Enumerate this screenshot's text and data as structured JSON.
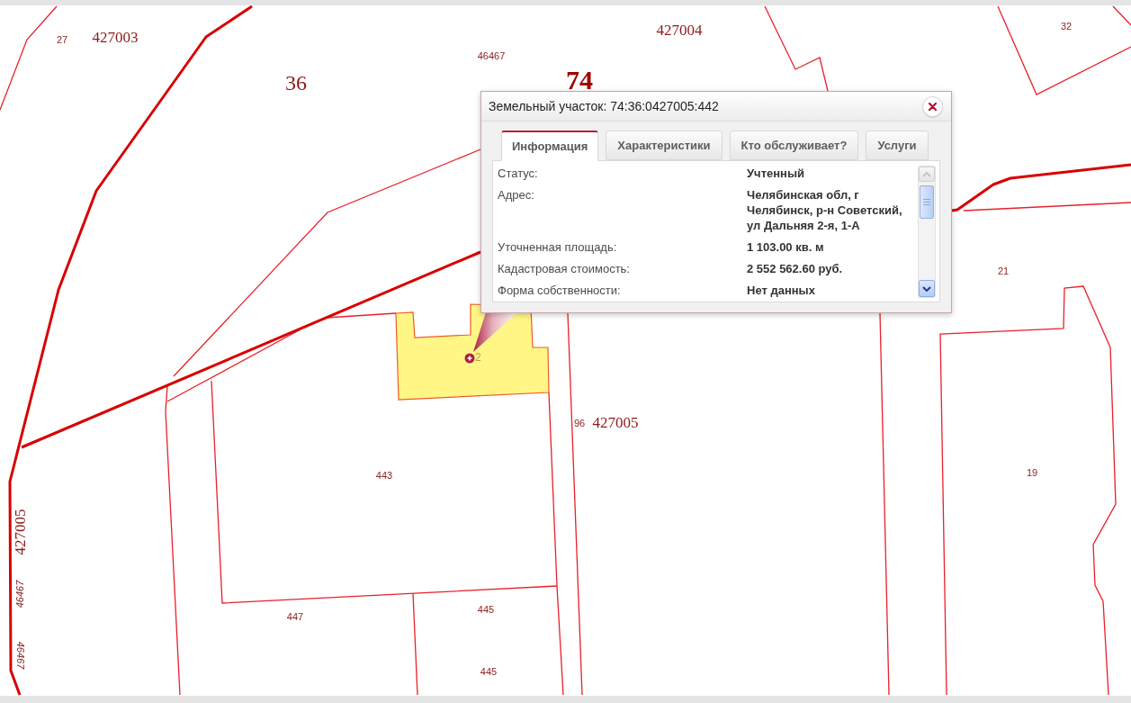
{
  "map": {
    "labels": [
      {
        "text": "27",
        "kind": "parcel"
      },
      {
        "text": "427003",
        "kind": "quarter"
      },
      {
        "text": "46467",
        "kind": "code"
      },
      {
        "text": "36",
        "kind": "district"
      },
      {
        "text": "74",
        "kind": "region"
      },
      {
        "text": "427004",
        "kind": "quarter"
      },
      {
        "text": "32",
        "kind": "parcel"
      },
      {
        "text": "21",
        "kind": "parcel"
      },
      {
        "text": "96",
        "kind": "parcel"
      },
      {
        "text": "427005",
        "kind": "quarter"
      },
      {
        "text": "443",
        "kind": "parcel"
      },
      {
        "text": "19",
        "kind": "parcel"
      },
      {
        "text": "447",
        "kind": "parcel"
      },
      {
        "text": "445",
        "kind": "parcel"
      },
      {
        "text": "445",
        "kind": "parcel"
      },
      {
        "text": "427005",
        "kind": "quarter"
      },
      {
        "text": "46467",
        "kind": "code"
      },
      {
        "text": "46467",
        "kind": "code"
      }
    ],
    "selected_parcel": {
      "marker_label": "2"
    }
  },
  "popup": {
    "title": "Земельный участок: 74:36:0427005:442",
    "tabs": [
      {
        "label": "Информация",
        "selected": true
      },
      {
        "label": "Характеристики",
        "selected": false
      },
      {
        "label": "Кто обслуживает?",
        "selected": false
      },
      {
        "label": "Услуги",
        "selected": false
      }
    ],
    "fields": [
      {
        "label": "Статус:",
        "value": "Учтенный"
      },
      {
        "label": "Адрес:",
        "value": "Челябинская обл, г Челябинск, р-н Советский, ул Дальняя 2-я, 1-А"
      },
      {
        "label": "Уточненная площадь:",
        "value": "1 103.00 кв. м"
      },
      {
        "label": "Кадастровая стоимость:",
        "value": "2 552 562.60 руб."
      },
      {
        "label": "Форма собственности:",
        "value": "Нет данных"
      }
    ]
  }
}
